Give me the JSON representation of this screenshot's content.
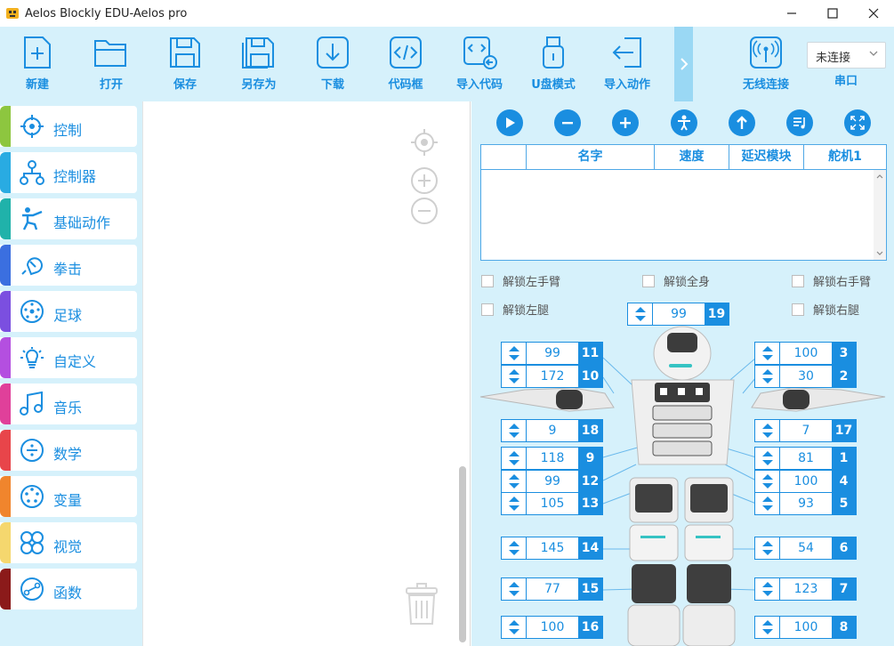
{
  "window": {
    "title": "Aelos Blockly EDU-Aelos pro"
  },
  "toolbar": {
    "new": "新建",
    "open": "打开",
    "save": "保存",
    "save_as": "另存为",
    "download": "下载",
    "code": "代码框",
    "import_code": "导入代码",
    "udisk": "U盘模式",
    "import_action": "导入动作",
    "wireless": "无线连接",
    "port_label": "串口",
    "port_value": "未连接"
  },
  "sidebar": {
    "items": [
      {
        "label": "控制",
        "color": "#8dc63f"
      },
      {
        "label": "控制器",
        "color": "#29abe2"
      },
      {
        "label": "基础动作",
        "color": "#20b2aa"
      },
      {
        "label": "拳击",
        "color": "#3b6fe0"
      },
      {
        "label": "足球",
        "color": "#7b4fe0"
      },
      {
        "label": "自定义",
        "color": "#b44fe0"
      },
      {
        "label": "音乐",
        "color": "#e0409a"
      },
      {
        "label": "数学",
        "color": "#e8454a"
      },
      {
        "label": "变量",
        "color": "#f0852d"
      },
      {
        "label": "视觉",
        "color": "#f5d76e"
      },
      {
        "label": "函数",
        "color": "#8b1a1a"
      }
    ]
  },
  "table": {
    "headers": [
      "",
      "名字",
      "速度",
      "延迟模块",
      "舵机1"
    ]
  },
  "checkboxes": {
    "left_arm": "解锁左手臂",
    "whole_body": "解锁全身",
    "right_arm": "解锁右手臂",
    "left_leg": "解锁左腿",
    "right_leg": "解锁右腿"
  },
  "servos": [
    {
      "id": "19",
      "value": "99"
    },
    {
      "id": "11",
      "value": "99"
    },
    {
      "id": "10",
      "value": "172"
    },
    {
      "id": "18",
      "value": "9"
    },
    {
      "id": "9",
      "value": "118"
    },
    {
      "id": "12",
      "value": "99"
    },
    {
      "id": "13",
      "value": "105"
    },
    {
      "id": "14",
      "value": "145"
    },
    {
      "id": "15",
      "value": "77"
    },
    {
      "id": "16",
      "value": "100"
    },
    {
      "id": "3",
      "value": "100"
    },
    {
      "id": "2",
      "value": "30"
    },
    {
      "id": "17",
      "value": "7"
    },
    {
      "id": "1",
      "value": "81"
    },
    {
      "id": "4",
      "value": "100"
    },
    {
      "id": "5",
      "value": "93"
    },
    {
      "id": "6",
      "value": "54"
    },
    {
      "id": "7",
      "value": "123"
    },
    {
      "id": "8",
      "value": "100"
    }
  ],
  "colors": {
    "accent": "#1a8ee0",
    "toolbar_bg": "#d6f1fb"
  }
}
